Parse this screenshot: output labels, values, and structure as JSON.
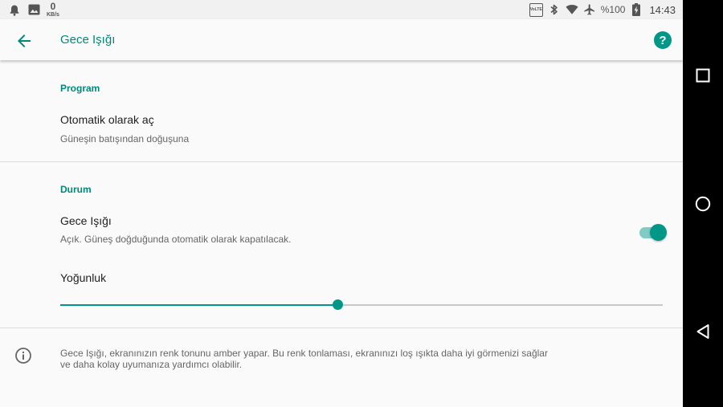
{
  "status_bar": {
    "net_speed_value": "0",
    "net_speed_unit": "KB/s",
    "volte_label": "VoLTE",
    "battery_percent": "%100",
    "time": "14:43",
    "icons": [
      "notification-bell-icon",
      "image-icon",
      "volte-icon",
      "bluetooth-icon",
      "wifi-icon",
      "airplane-icon",
      "battery-charging-icon"
    ]
  },
  "app_bar": {
    "title": "Gece Işığı",
    "back_icon": "arrow-left-icon",
    "help_label": "?"
  },
  "program_section": {
    "header": "Program",
    "auto_on": {
      "title": "Otomatik olarak aç",
      "summary": "Güneşin batışından doğuşuna"
    }
  },
  "status_section": {
    "header": "Durum",
    "night_light": {
      "title": "Gece Işığı",
      "summary": "Açık. Güneş doğduğunda otomatik olarak kapatılacak.",
      "enabled": true
    },
    "intensity": {
      "title": "Yoğunluk",
      "value_fraction": 0.46
    }
  },
  "info": {
    "icon": "info-icon",
    "text": "Gece Işığı, ekranınızın renk tonunu amber yapar. Bu renk tonlaması, ekranınızı loş ışıkta daha iyi görmenizi sağlar ve daha kolay uyumanıza yardımcı olabilir."
  },
  "colors": {
    "accent": "#009688",
    "accent_light": "#80cbc4",
    "title_text": "#212121",
    "summary_text": "#666666"
  },
  "nav_bar": {
    "icons": [
      "recents-square-icon",
      "home-circle-icon",
      "back-triangle-icon"
    ]
  }
}
